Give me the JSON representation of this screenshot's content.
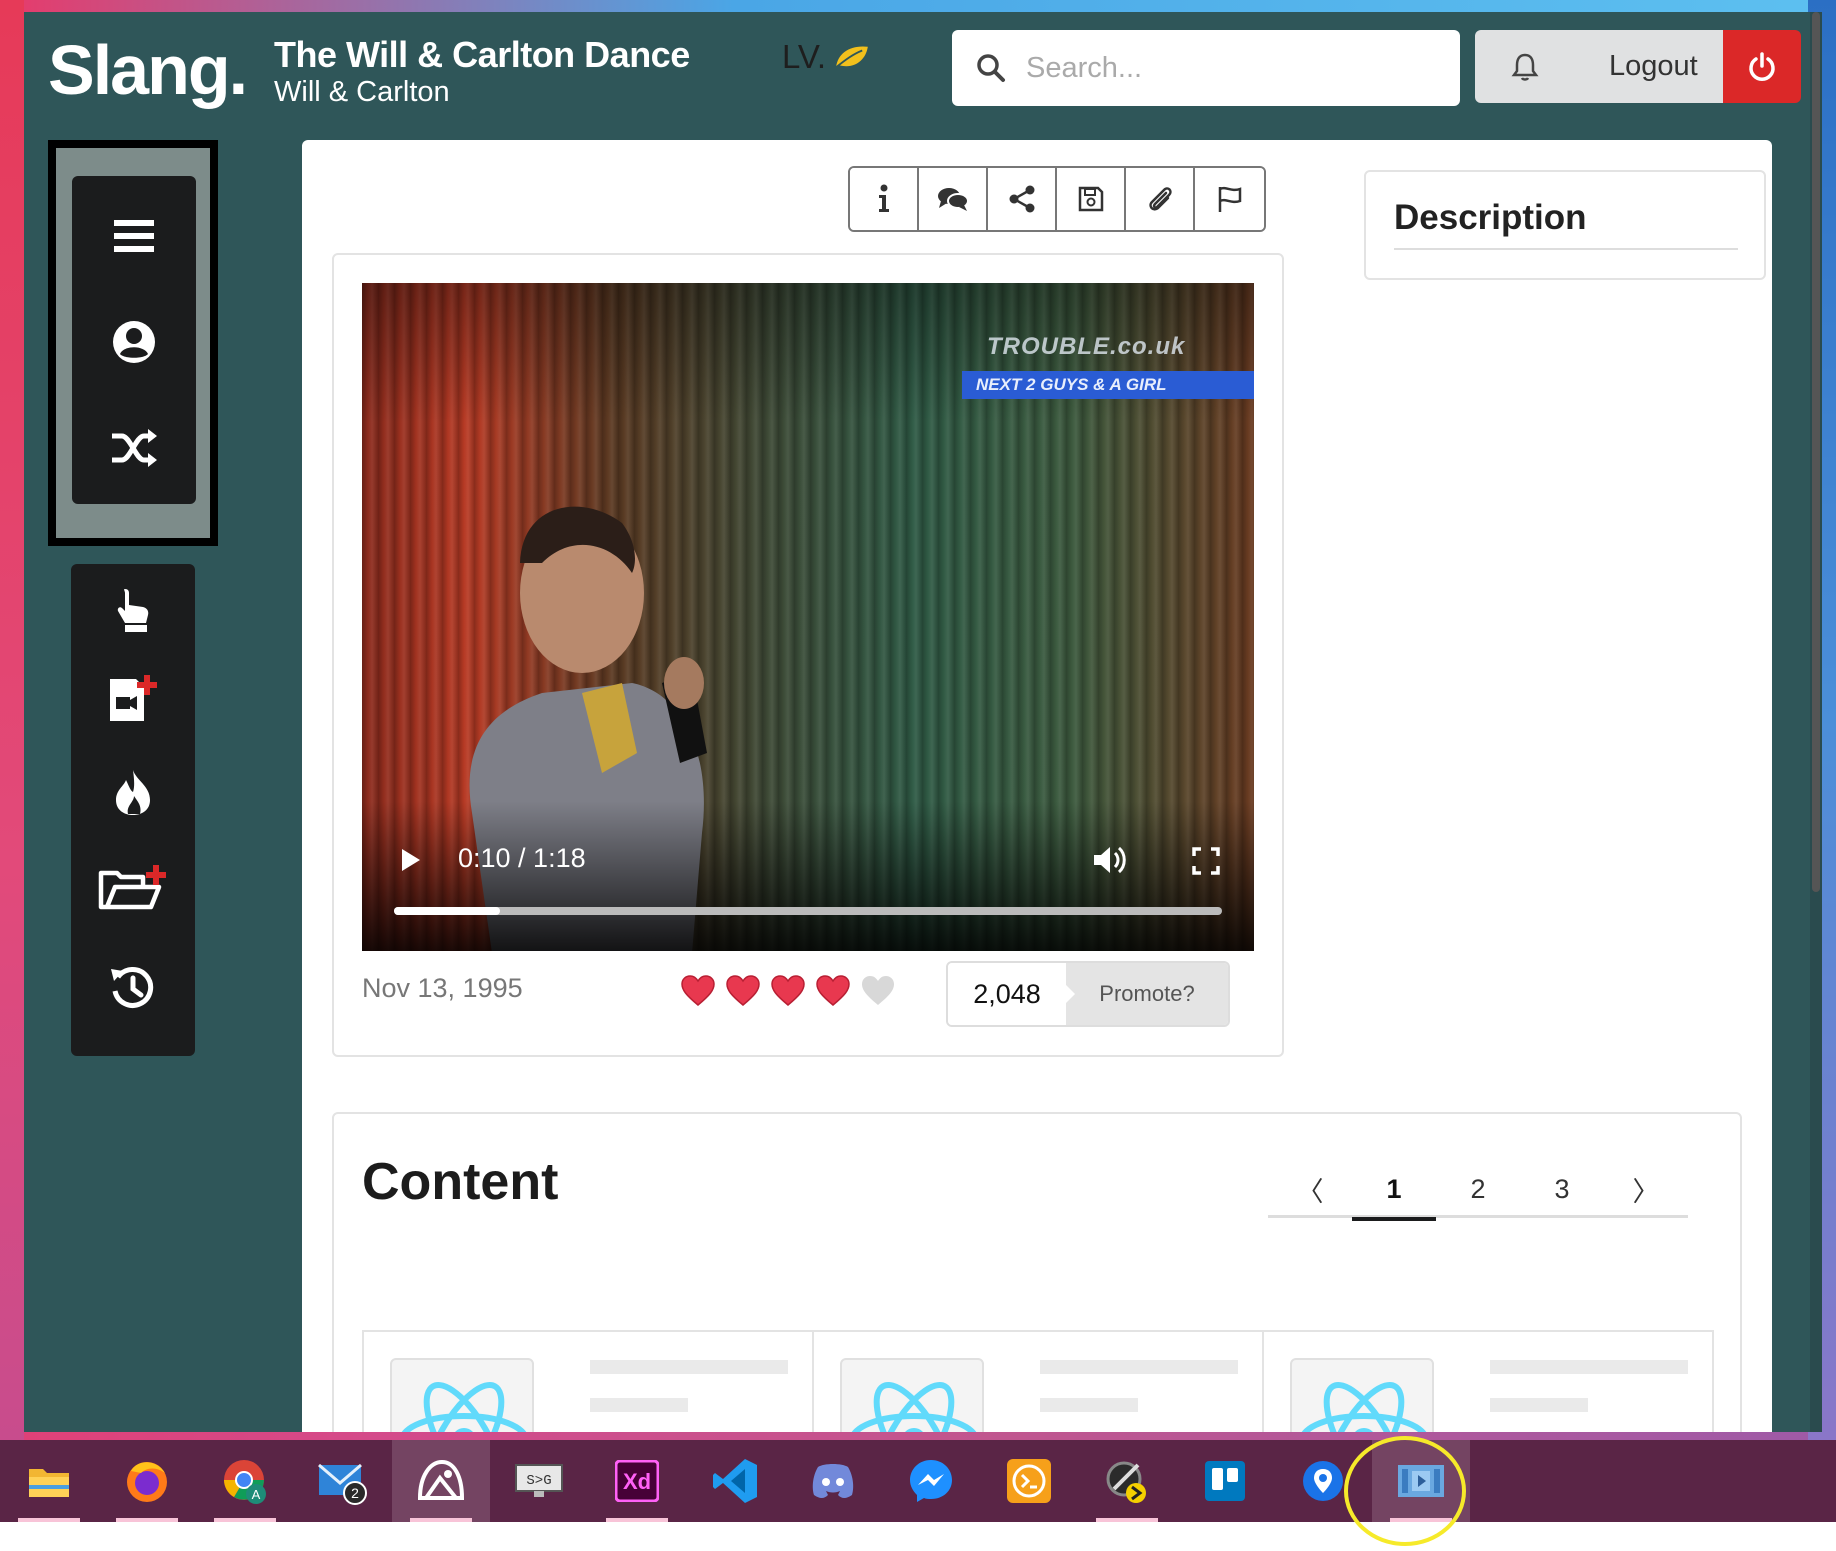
{
  "header": {
    "brand": "Slang.",
    "video_title": "The Will & Carlton Dance",
    "video_subtitle": "Will & Carlton",
    "level_label": "LV.",
    "search_placeholder": "Search...",
    "logout_label": "Logout"
  },
  "sidebar": {
    "top_items": [
      "menu-icon",
      "user-icon",
      "shuffle-icon"
    ],
    "bottom_items": [
      "hand-pointer-icon",
      "add-video-icon",
      "fire-icon",
      "add-folder-icon",
      "history-icon"
    ]
  },
  "toolbar": {
    "buttons": [
      "info-icon",
      "comments-icon",
      "share-icon",
      "save-icon",
      "attach-icon",
      "flag-icon"
    ]
  },
  "video": {
    "overlay_logo": "TROUBLE.co.uk",
    "overlay_banner": "NEXT 2 GUYS & A GIRL",
    "time_display": "0:10 / 1:18",
    "progress_fraction": 0.128,
    "date": "Nov 13, 1995",
    "rating": 4,
    "rating_max": 5,
    "promote_count": "2,048",
    "promote_label": "Promote?"
  },
  "description": {
    "heading": "Description"
  },
  "content": {
    "heading": "Content",
    "pagination": {
      "prev": "〈",
      "pages": [
        "1",
        "2",
        "3"
      ],
      "active_page": "1",
      "next": "〉"
    },
    "item_count": 3
  },
  "taskbar": {
    "apps": [
      "file-explorer-icon",
      "firefox-icon",
      "chrome-icon",
      "mail-icon",
      "drawboard-icon",
      "sxg-icon",
      "adobe-xd-icon",
      "vscode-icon",
      "discord-icon",
      "messenger-icon",
      "terminal-icon",
      "stylus-icon",
      "trello-icon",
      "maps-icon",
      "video-editor-icon"
    ],
    "mail_badge": "2",
    "xd_label": "Xd",
    "sxg_label": "S>G",
    "chrome_profile": "A"
  },
  "colors": {
    "app_bg": "#2f5659",
    "danger": "#db2828",
    "heart": "#e8384f",
    "react_blue": "#61dafb",
    "taskbar": "#5a2546",
    "annotation": "#f6ea2a"
  }
}
